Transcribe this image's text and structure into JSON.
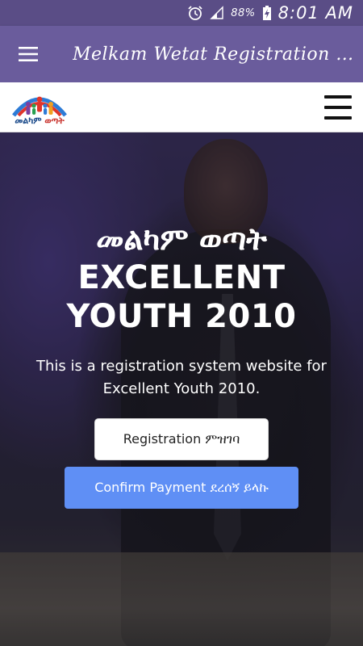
{
  "status_bar": {
    "battery_percent": "88%",
    "time": "8:01 AM",
    "icons": [
      "alarm-clock-icon",
      "signal-icon",
      "battery-charging-icon"
    ]
  },
  "app_bar": {
    "title": "Melkam Wetat Registration S...",
    "menu_icon": "hamburger-menu-icon",
    "color": "#6a5c9c"
  },
  "site_nav": {
    "logo_text_blue": "መልካም",
    "logo_text_red": "ወጣት",
    "menu_icon": "hamburger-menu-icon"
  },
  "hero": {
    "title_amharic": "መልካም ወጣት",
    "title_line1": "EXCELLENT",
    "title_line2": "YOUTH 2010",
    "description": "This is a registration system website for Excellent Youth 2010.",
    "register_button": "Registration ምዝገባ",
    "confirm_button": "Confirm Payment ደረሰኝ ይላኩ",
    "confirm_color": "#5f8ff5"
  }
}
